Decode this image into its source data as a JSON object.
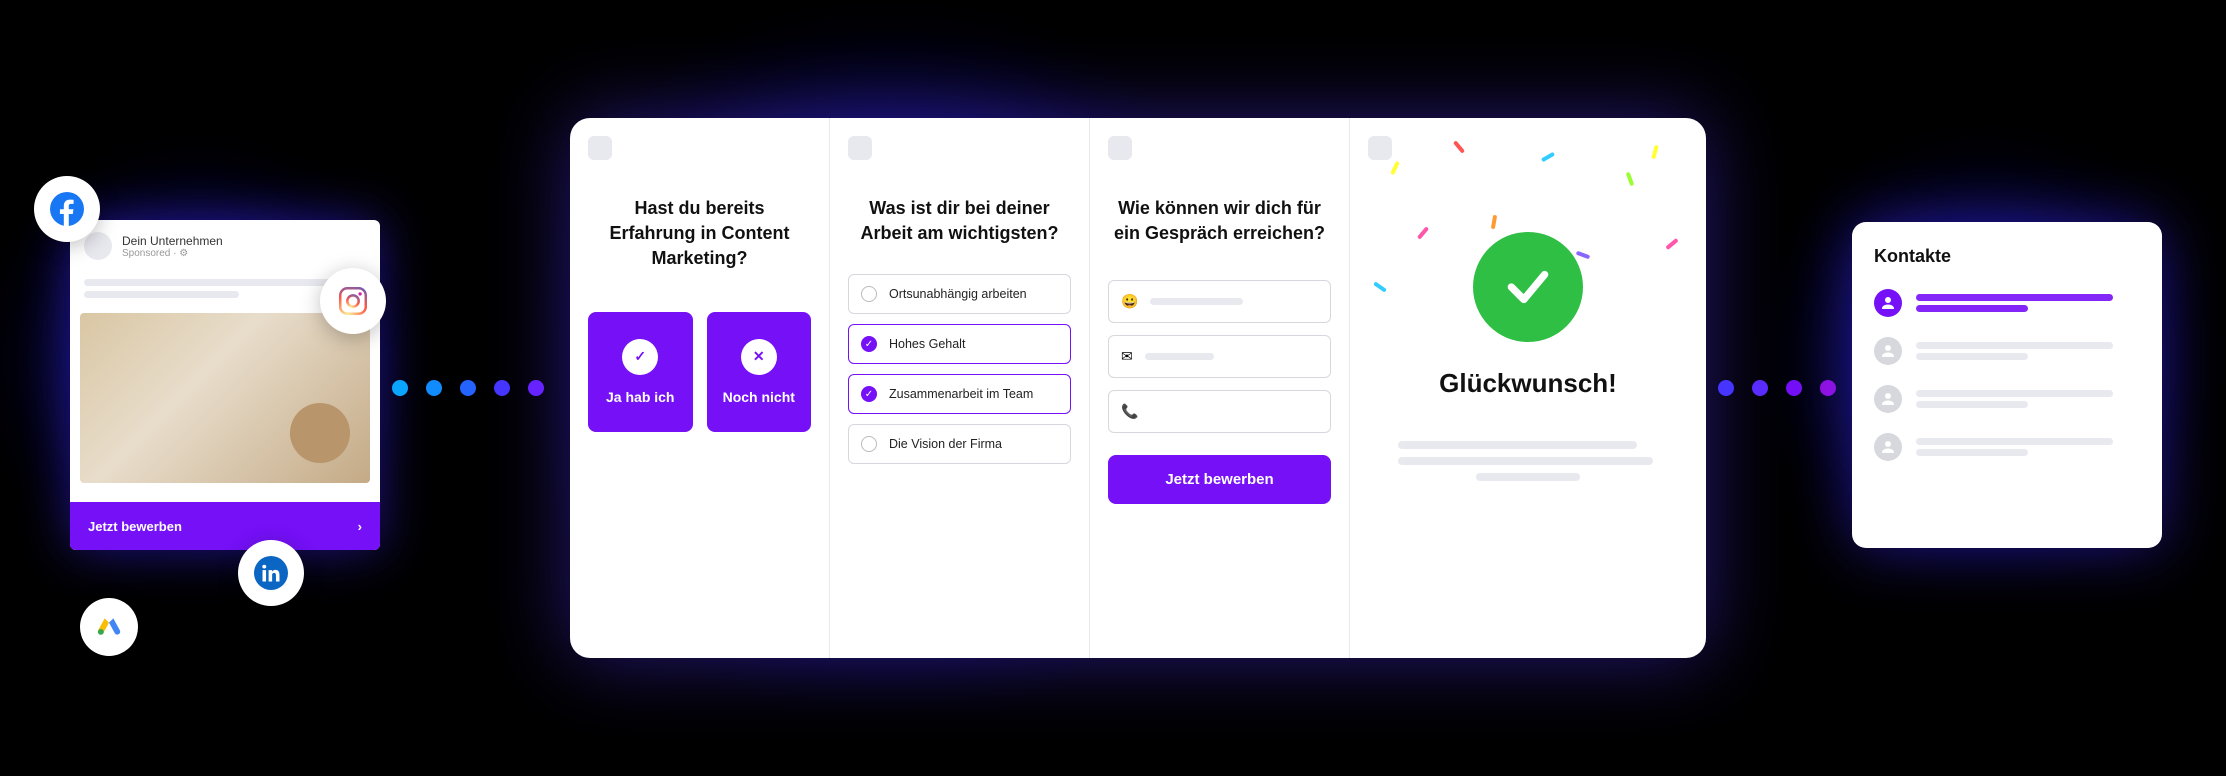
{
  "ad": {
    "company": "Dein Unternehmen",
    "sponsored": "Sponsored · ⚙",
    "cta": "Jetzt bewerben"
  },
  "social_icons": [
    "facebook",
    "instagram",
    "linkedin",
    "google-ads"
  ],
  "funnel": {
    "step1": {
      "question": "Hast du bereits Erfahrung in Content Marketing?",
      "yes": "Ja hab ich",
      "no": "Noch nicht"
    },
    "step2": {
      "question": "Was ist dir bei deiner Arbeit am wichtigsten?",
      "options": [
        {
          "label": "Ortsunabhängig arbeiten",
          "selected": false
        },
        {
          "label": "Hohes Gehalt",
          "selected": true
        },
        {
          "label": "Zusammenarbeit im Team",
          "selected": true
        },
        {
          "label": "Die Vision der Firma",
          "selected": false
        }
      ]
    },
    "step3": {
      "question": "Wie können wir dich für ein Gespräch erreichen?",
      "fields": [
        {
          "icon": "😀"
        },
        {
          "icon": "✉"
        },
        {
          "icon": "📞"
        }
      ],
      "submit": "Jetzt bewerben"
    },
    "step4": {
      "title": "Glückwunsch!"
    }
  },
  "contacts": {
    "title": "Kontakte",
    "rows": 4
  }
}
